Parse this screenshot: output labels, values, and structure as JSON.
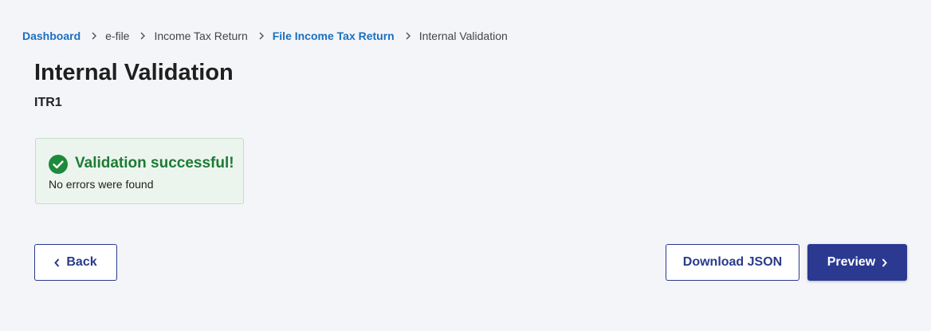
{
  "breadcrumb": {
    "items": [
      {
        "label": "Dashboard",
        "link": true
      },
      {
        "label": "e-file",
        "link": false
      },
      {
        "label": "Income Tax Return",
        "link": false
      },
      {
        "label": "File Income Tax Return",
        "link": true
      },
      {
        "label": "Internal Validation",
        "link": false
      }
    ],
    "separator_icon": "chevron-right-icon"
  },
  "header": {
    "title": "Internal Validation",
    "subtitle": "ITR1"
  },
  "alert": {
    "icon": "check-circle-icon",
    "title": "Validation successful!",
    "message": "No errors were found"
  },
  "actions": {
    "back_label": "Back",
    "download_label": "Download JSON",
    "preview_label": "Preview"
  },
  "colors": {
    "background": "#f4f5f9",
    "link": "#1a6fbf",
    "primary": "#2b3990",
    "success": "#1e7a34",
    "success_bg": "#ebf5ee"
  }
}
